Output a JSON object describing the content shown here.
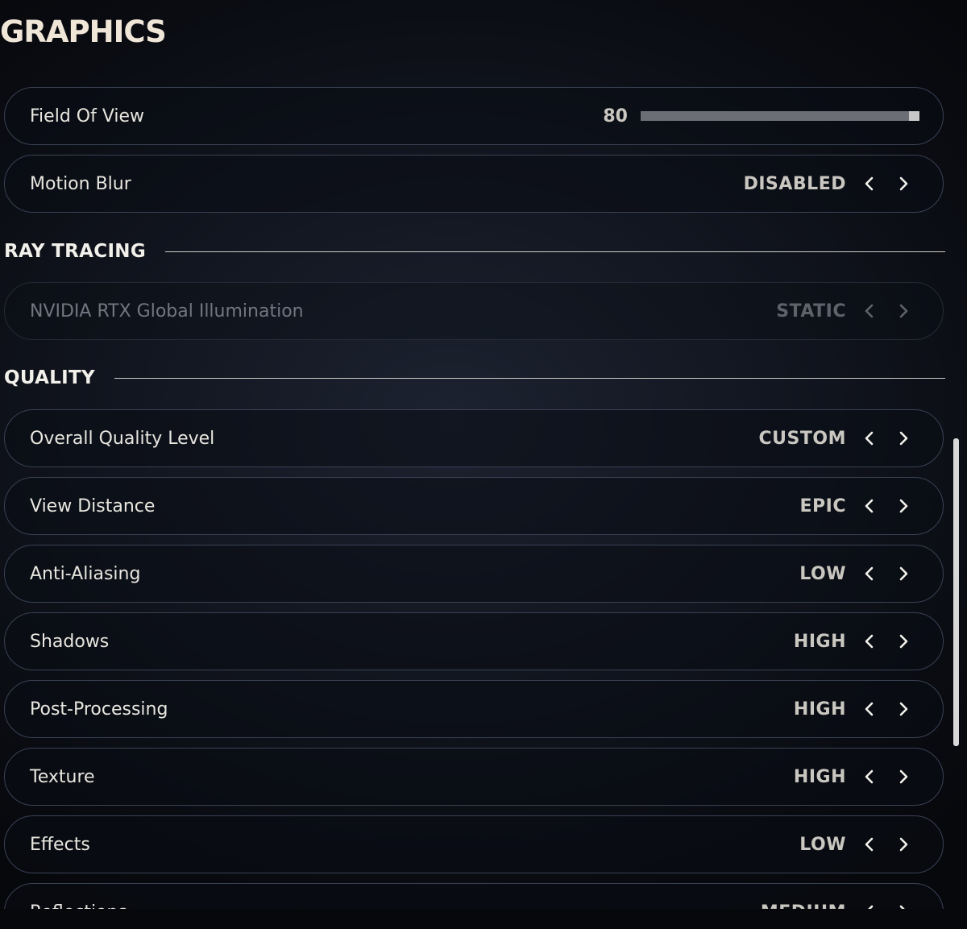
{
  "page": {
    "title": "GRAPHICS"
  },
  "colors": {
    "accent_text": "#f0e6d8",
    "row_border": "#3a4154",
    "disabled_text": "#737680",
    "scrollbar": "#d8d8d8"
  },
  "top_settings": [
    {
      "label": "Field Of View",
      "type": "slider",
      "value": "80",
      "slider_fraction": 1.0
    },
    {
      "label": "Motion Blur",
      "type": "selector",
      "value": "DISABLED"
    }
  ],
  "sections": {
    "ray_tracing": {
      "label": "RAY TRACING",
      "items": [
        {
          "label": "NVIDIA RTX Global Illumination",
          "value": "STATIC",
          "disabled": true
        }
      ]
    },
    "quality": {
      "label": "QUALITY",
      "items": [
        {
          "label": "Overall Quality Level",
          "value": "CUSTOM"
        },
        {
          "label": "View Distance",
          "value": "EPIC"
        },
        {
          "label": "Anti-Aliasing",
          "value": "LOW"
        },
        {
          "label": "Shadows",
          "value": "HIGH"
        },
        {
          "label": "Post-Processing",
          "value": "HIGH"
        },
        {
          "label": "Texture",
          "value": "HIGH"
        },
        {
          "label": "Effects",
          "value": "LOW"
        },
        {
          "label": "Reflections",
          "value": "MEDIUM"
        }
      ]
    }
  },
  "icons": {
    "prev": "chevron-left-icon",
    "next": "chevron-right-icon"
  }
}
